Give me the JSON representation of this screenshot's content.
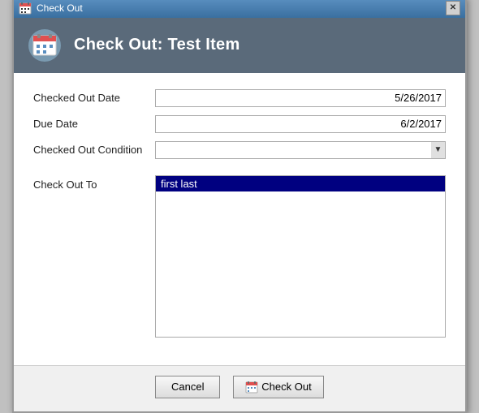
{
  "window": {
    "title": "Check Out",
    "close_label": "✕"
  },
  "header": {
    "title": "Check Out: Test Item"
  },
  "form": {
    "checked_out_date_label": "Checked Out Date",
    "checked_out_date_value": "5/26/2017",
    "due_date_label": "Due Date",
    "due_date_value": "6/2/2017",
    "checked_out_condition_label": "Checked Out Condition",
    "checked_out_condition_value": "",
    "check_out_to_label": "Check Out To",
    "check_out_to_selected": "first last"
  },
  "buttons": {
    "cancel_label": "Cancel",
    "checkout_label": "Check Out"
  },
  "icons": {
    "down_arrow": "▼"
  }
}
